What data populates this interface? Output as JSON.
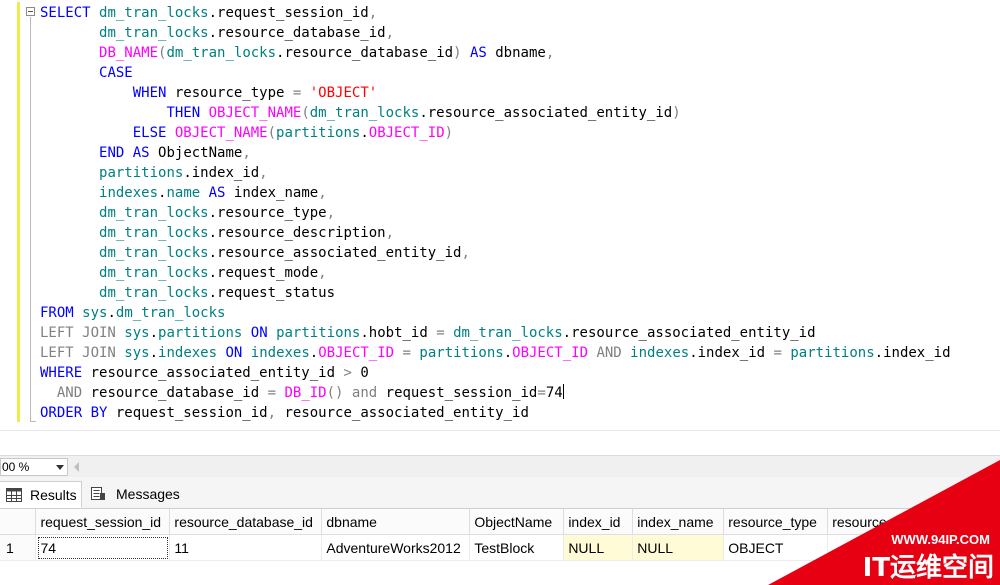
{
  "zoom": {
    "value": "00 %"
  },
  "tabs": {
    "results_label": "Results",
    "messages_label": "Messages"
  },
  "grid": {
    "columns": [
      "request_session_id",
      "resource_database_id",
      "dbname",
      "ObjectName",
      "index_id",
      "index_name",
      "resource_type",
      "resource"
    ],
    "row_number": "1",
    "rows": [
      [
        "74",
        "11",
        "AdventureWorks2012",
        "TestBlock",
        "NULL",
        "NULL",
        "OBJECT",
        ""
      ]
    ]
  },
  "watermark": {
    "url": "WWW.94IP.COM",
    "text": "IT运维空间"
  },
  "colors": {
    "keyword": "#0000ff",
    "function": "#ff00ff",
    "table": "#008080",
    "operator": "#808080",
    "string": "#ff0000",
    "null_cell": "#fffbd6",
    "watermark_red": "#e60012"
  }
}
